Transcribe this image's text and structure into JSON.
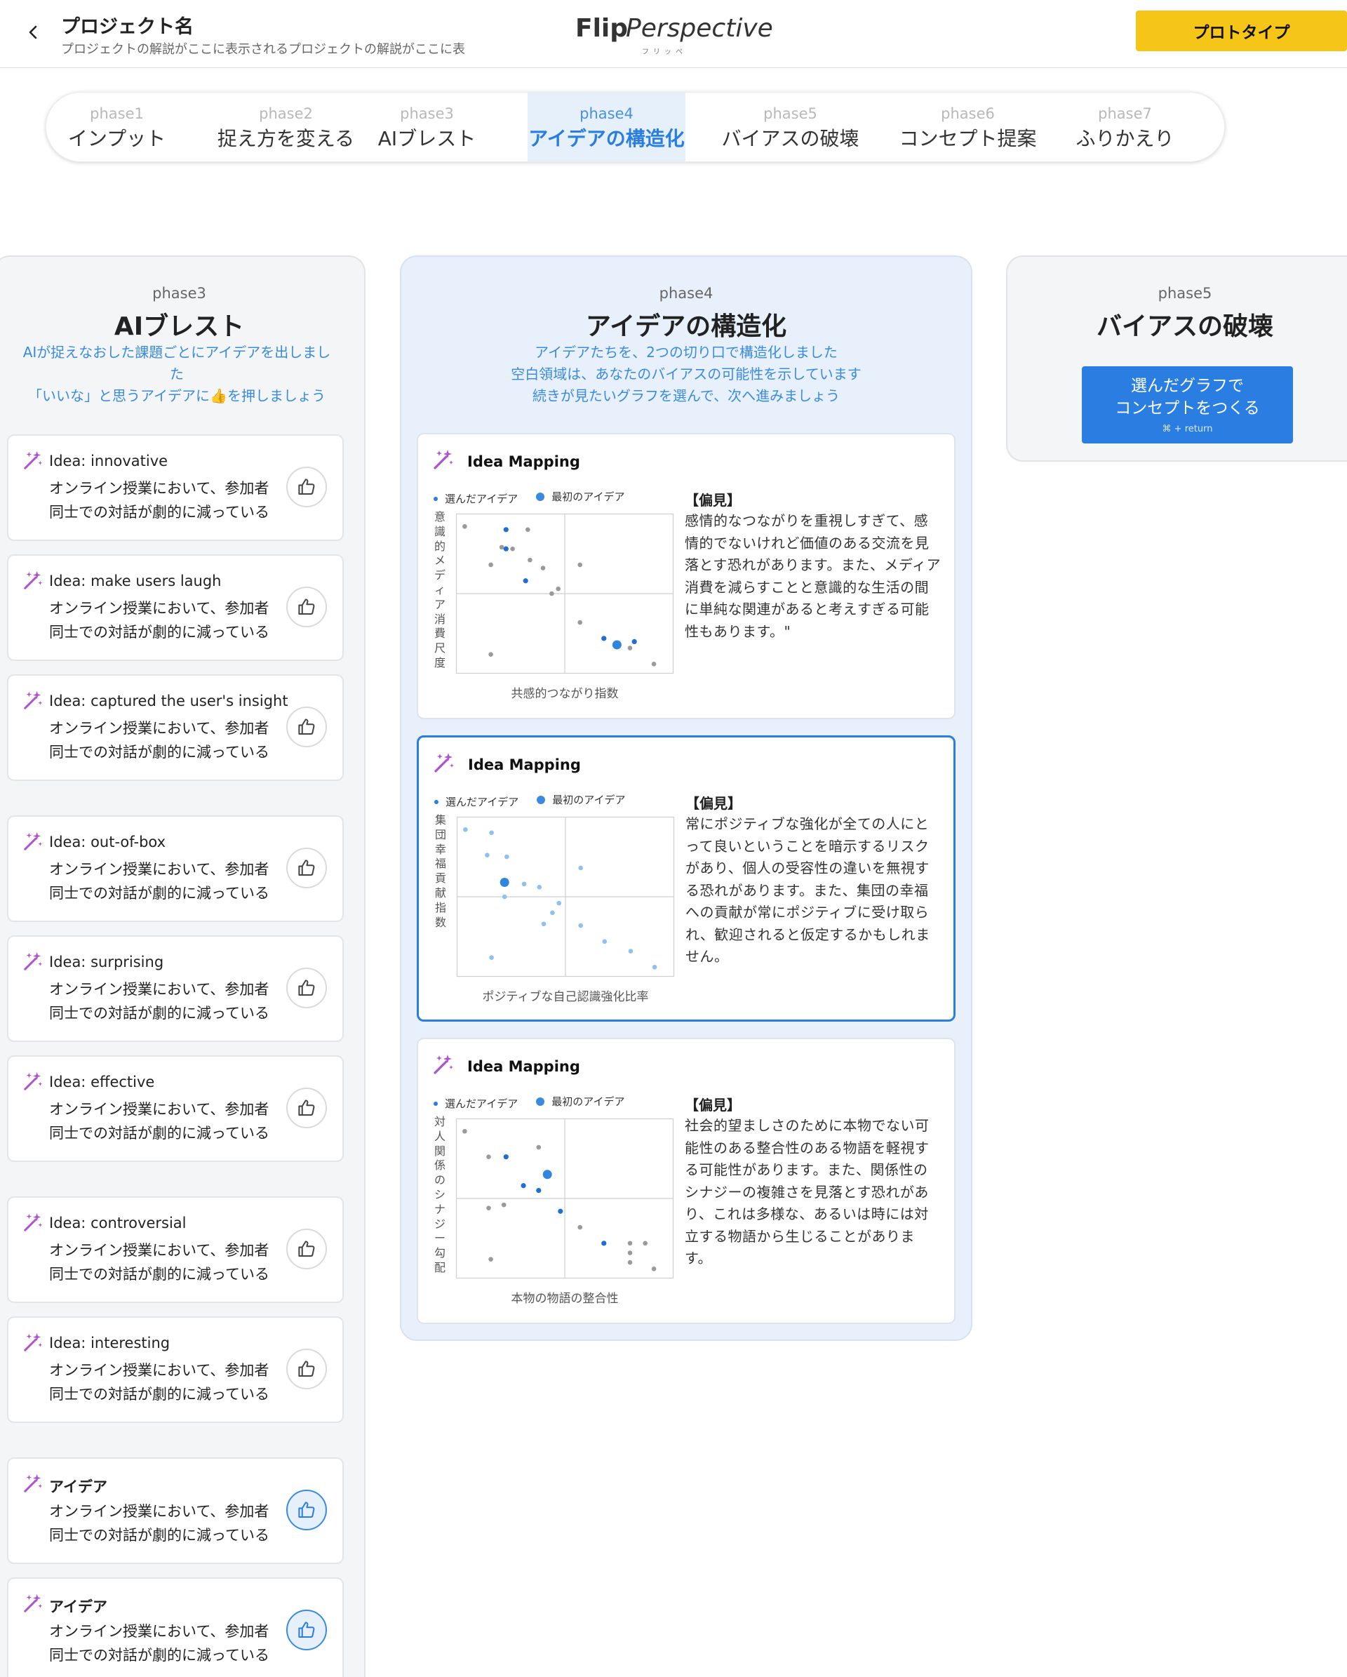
{
  "header": {
    "project_title": "プロジェクト名",
    "project_desc": "プロジェクトの解説がここに表示されるプロジェクトの解説がここに表",
    "logo_flip": "Flip",
    "logo_perspective": "Perspective",
    "logo_sub": "フリッペ",
    "prototype_label": "プロトタイプ",
    "accent": "#f5c518"
  },
  "tabs": [
    {
      "phase": "phase1",
      "label": "インプット"
    },
    {
      "phase": "phase2",
      "label": "捉え方を変える"
    },
    {
      "phase": "phase3",
      "label": "AIブレスト"
    },
    {
      "phase": "phase4",
      "label": "アイデアの構造化",
      "active": true
    },
    {
      "phase": "phase5",
      "label": "バイアスの破壊"
    },
    {
      "phase": "phase6",
      "label": "コンセプト提案"
    },
    {
      "phase": "phase7",
      "label": "ふりかえり"
    }
  ],
  "col3": {
    "phase": "phase3",
    "title": "AIブレスト",
    "desc": "AIが捉えなおした課題ごとにアイデアを出しました\n「いいな」と思うアイデアに👍を押しましょう",
    "ideas": [
      {
        "title": "Idea: innovative",
        "text": "オンライン授業において、参加者同士での対話が劇的に減っている",
        "liked": false
      },
      {
        "title": "Idea: make users laugh",
        "text": "オンライン授業において、参加者同士での対話が劇的に減っている",
        "liked": false
      },
      {
        "title": "Idea: captured the user's insight",
        "text": "オンライン授業において、参加者同士での対話が劇的に減っている",
        "liked": false
      },
      {
        "title": "Idea: out-of-box",
        "text": "オンライン授業において、参加者同士での対話が劇的に減っている",
        "liked": false
      },
      {
        "title": "Idea: surprising",
        "text": "オンライン授業において、参加者同士での対話が劇的に減っている",
        "liked": false
      },
      {
        "title": "Idea: effective",
        "text": "オンライン授業において、参加者同士での対話が劇的に減っている",
        "liked": false
      },
      {
        "title": "Idea: controversial",
        "text": "オンライン授業において、参加者同士での対話が劇的に減っている",
        "liked": false
      },
      {
        "title": "Idea: interesting",
        "text": "オンライン授業において、参加者同士での対話が劇的に減っている",
        "liked": false
      },
      {
        "title": "アイデア",
        "text": "オンライン授業において、参加者同士での対話が劇的に減っている",
        "liked": true
      },
      {
        "title": "アイデア",
        "text": "オンライン授業において、参加者同士での対話が劇的に減っている",
        "liked": true
      }
    ]
  },
  "col4": {
    "phase": "phase4",
    "title": "アイデアの構造化",
    "desc": "アイデアたちを、2つの切り口で構造化しました\n空白領域は、あなたのバイアスの可能性を示しています\n続きが見たいグラフを選んで、次へ進みましょう",
    "legend_selected": "選んだアイデア",
    "legend_initial": "最初のアイデア",
    "maps": [
      {
        "title": "Idea Mapping",
        "ylabel": "意識的メディア消費尺度",
        "xlabel": "共感的つながり指数",
        "bias_head": "【偏見】",
        "bias_text": "感情的なつながりを重視しすぎて、感情的でないけれど価値のある交流を見落とす恐れがあります。また、メディア消費を減らすことと意識的な生活の間に単純な関連があると考えすぎる可能性もあります。\"",
        "selected": false,
        "palette": "gray",
        "chart_data": {
          "type": "scatter",
          "xlim": [
            0,
            100
          ],
          "ylim": [
            0,
            100
          ],
          "other": [
            [
              4,
              92
            ],
            [
              16,
              68
            ],
            [
              16,
              12
            ],
            [
              26,
              78
            ],
            [
              33,
              90
            ],
            [
              34,
              71
            ],
            [
              44,
              50
            ],
            [
              47,
              53
            ],
            [
              57,
              68
            ],
            [
              57,
              32
            ],
            [
              80,
              16
            ],
            [
              91,
              6
            ],
            [
              21,
              79
            ],
            [
              40,
              66
            ]
          ],
          "selected": [
            [
              23,
              90
            ],
            [
              23,
              78
            ],
            [
              32,
              58
            ],
            [
              68,
              22
            ],
            [
              82,
              20
            ]
          ],
          "initial": [
            [
              74,
              18
            ]
          ]
        }
      },
      {
        "title": "Idea Mapping",
        "ylabel": "集団幸福貢献指数",
        "xlabel": "ポジティブな自己認識強化比率",
        "bias_head": "【偏見】",
        "bias_text": "常にポジティブな強化が全ての人にとって良いということを暗示するリスクがあり、個人の受容性の違いを無視する恐れがあります。また、集団の幸福への貢献が常にポジティブに受け取られ、歓迎されると仮定するかもしれません。",
        "selected": true,
        "palette": "blue",
        "chart_data": {
          "type": "scatter",
          "xlim": [
            0,
            100
          ],
          "ylim": [
            0,
            100
          ],
          "other": [
            [
              4,
              92
            ],
            [
              16,
              90
            ],
            [
              16,
              12
            ],
            [
              14,
              76
            ],
            [
              23,
              75
            ],
            [
              31,
              58
            ],
            [
              38,
              56
            ],
            [
              22,
              50
            ],
            [
              44,
              40
            ],
            [
              47,
              46
            ],
            [
              57,
              68
            ],
            [
              40,
              33
            ],
            [
              57,
              32
            ],
            [
              68,
              22
            ],
            [
              80,
              16
            ],
            [
              91,
              6
            ]
          ],
          "selected": [],
          "initial": [
            [
              22,
              59
            ]
          ]
        }
      },
      {
        "title": "Idea Mapping",
        "ylabel": "対人関係のシナジー勾配",
        "xlabel": "本物の物語の整合性",
        "bias_head": "【偏見】",
        "bias_text": "社会的望ましさのために本物でない可能性のある整合性のある物語を軽視する可能性があります。また、関係性のシナジーの複雑さを見落とす恐れがあり、これは多様な、あるいは時には対立する物語から生じることがあります。",
        "selected": false,
        "palette": "gray",
        "chart_data": {
          "type": "scatter",
          "xlim": [
            0,
            100
          ],
          "ylim": [
            0,
            100
          ],
          "other": [
            [
              4,
              92
            ],
            [
              15,
              76
            ],
            [
              15,
              44
            ],
            [
              22,
              46
            ],
            [
              38,
              82
            ],
            [
              57,
              32
            ],
            [
              16,
              12
            ],
            [
              80,
              22
            ],
            [
              80,
              16
            ],
            [
              87,
              22
            ],
            [
              91,
              6
            ],
            [
              80,
              10
            ]
          ],
          "selected": [
            [
              23,
              76
            ],
            [
              31,
              58
            ],
            [
              38,
              55
            ],
            [
              48,
              42
            ],
            [
              68,
              22
            ]
          ],
          "initial": [
            [
              42,
              65
            ]
          ]
        }
      }
    ]
  },
  "col5": {
    "phase": "phase5",
    "title": "バイアスの破壊",
    "button_label": "選んだグラフで\nコンセプトをつくる",
    "button_key": "⌘ + return"
  },
  "colors": {
    "primary": "#2a7de1",
    "accent_yellow": "#f5c518",
    "wand": "#b04fd0"
  }
}
